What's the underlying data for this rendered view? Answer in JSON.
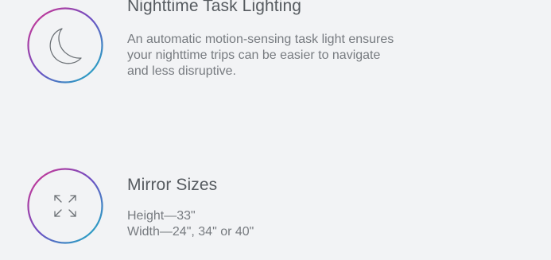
{
  "colors": {
    "background": "#f2f3f5",
    "ring_gradient_start": "#d6338e",
    "ring_gradient_mid": "#6d4fc3",
    "ring_gradient_end": "#16b8c4",
    "icon_stroke": "#6b7075",
    "title_text": "#555a5f",
    "body_text": "#777b80"
  },
  "features": {
    "night_lighting": {
      "icon": "crescent-moon-icon",
      "title": "Nighttime Task Lighting",
      "lines": [
        "An automatic motion-sensing task light ensures",
        "your nighttime trips can be easier to navigate",
        "and less disruptive."
      ]
    },
    "mirror_sizes": {
      "icon": "expand-arrows-icon",
      "title": "Mirror Sizes",
      "lines": [
        "Height—33\"",
        "Width—24\", 34\" or 40\""
      ]
    }
  }
}
